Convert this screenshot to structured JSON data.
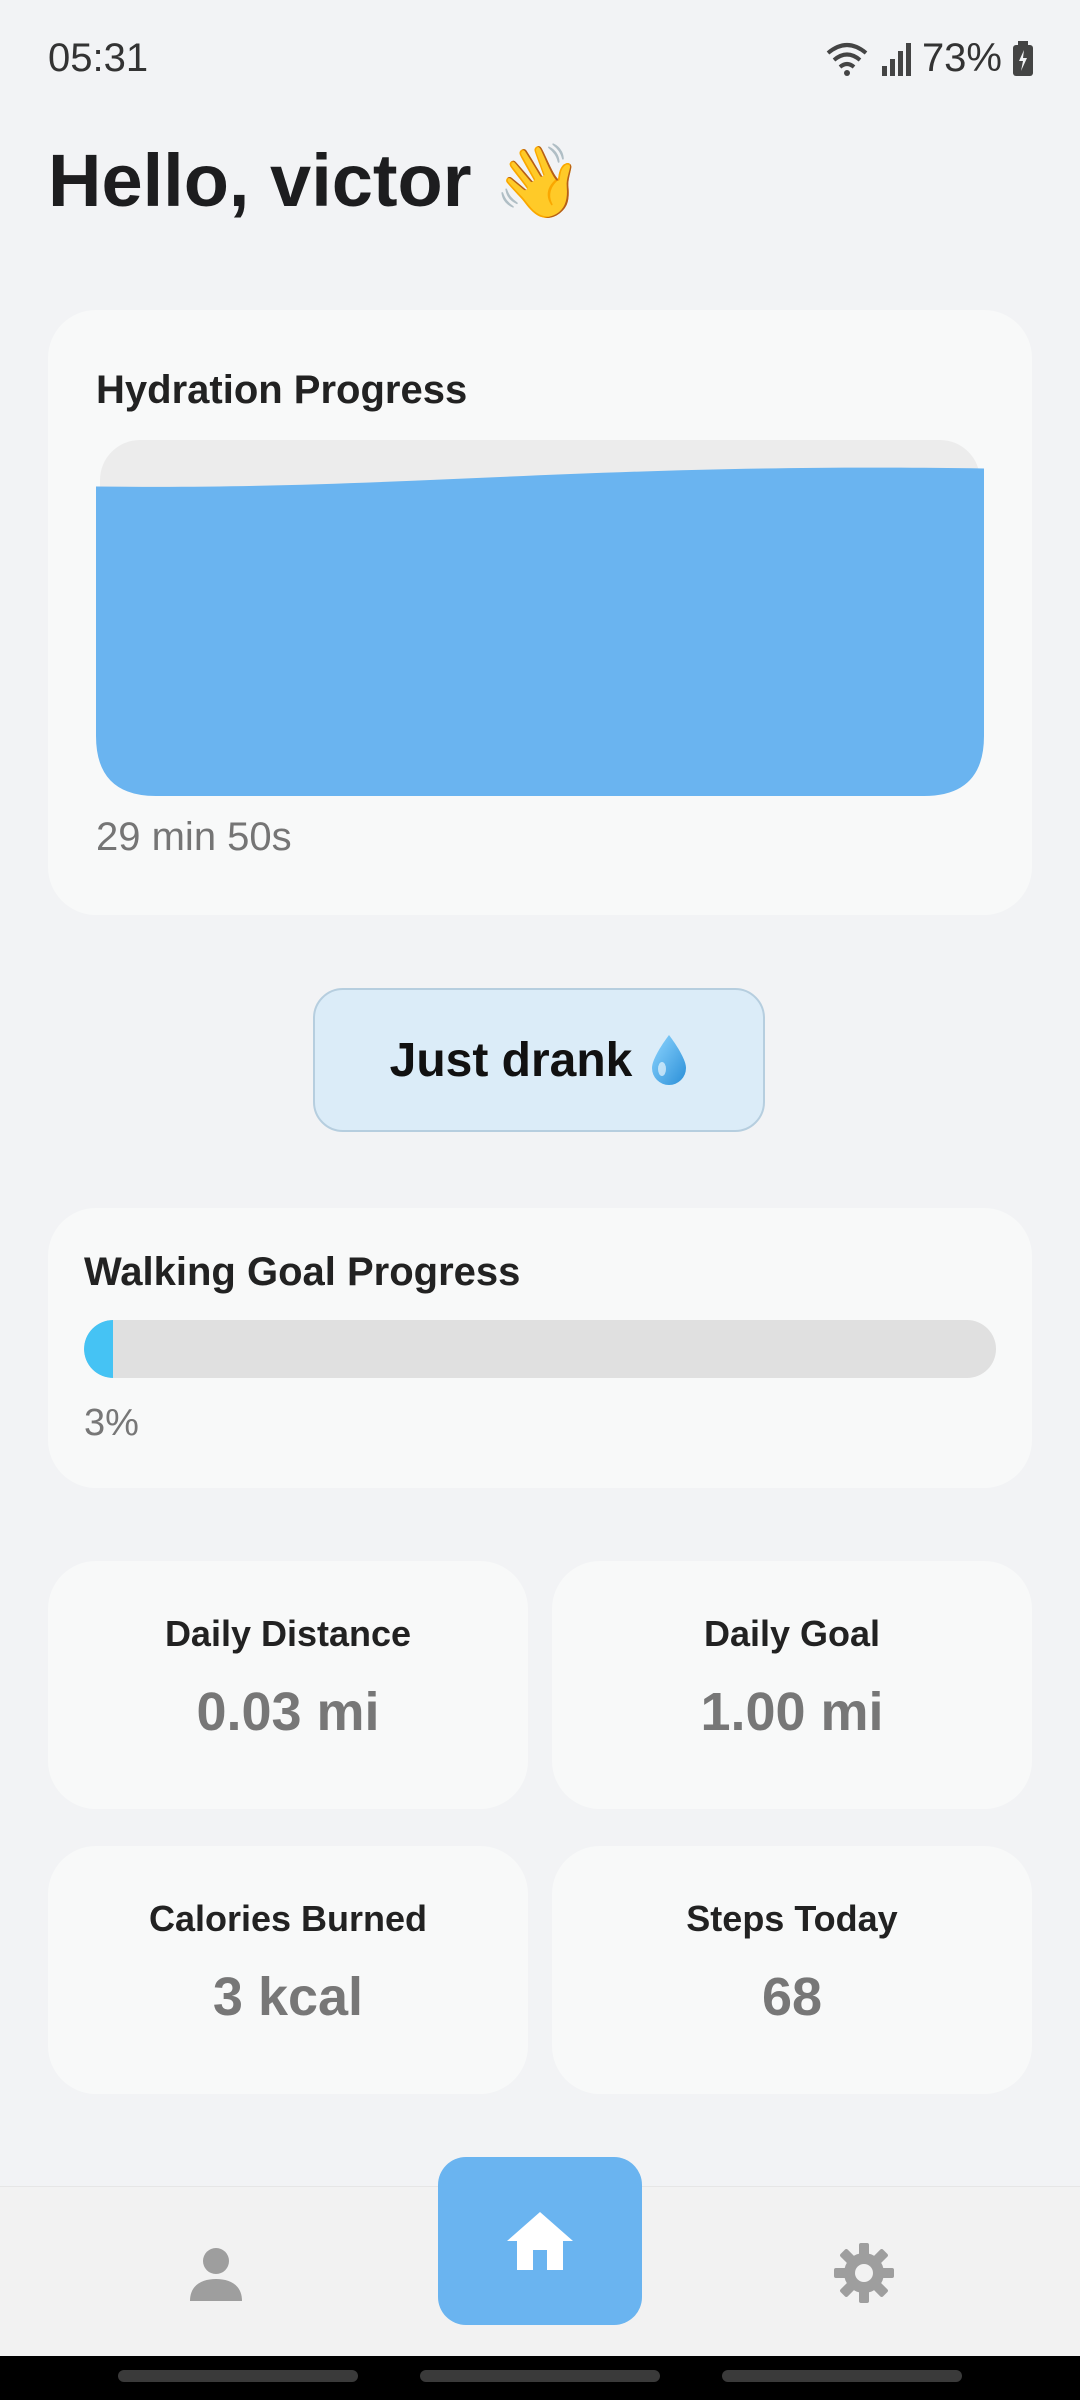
{
  "status_bar": {
    "time": "05:31",
    "battery": "73%"
  },
  "greeting": {
    "text": "Hello, victor",
    "emoji": "👋"
  },
  "hydration": {
    "title": "Hydration Progress",
    "time_text": "29 min 50s",
    "fill_level": 0.92,
    "water_color": "#6ab4f0"
  },
  "drink_button": {
    "label": "Just drank"
  },
  "walking": {
    "title": "Walking Goal Progress",
    "percent_text": "3%",
    "progress": 0.03,
    "bar_color": "#45c3f4"
  },
  "stats": [
    {
      "label": "Daily Distance",
      "value": "0.03 mi"
    },
    {
      "label": "Daily Goal",
      "value": "1.00 mi"
    },
    {
      "label": "Calories Burned",
      "value": "3 kcal"
    },
    {
      "label": "Steps Today",
      "value": "68"
    }
  ],
  "nav": {
    "items": [
      {
        "icon": "person-icon",
        "active": false
      },
      {
        "icon": "home-icon",
        "active": true
      },
      {
        "icon": "gear-icon",
        "active": false
      }
    ],
    "active_color": "#6ab4f0"
  }
}
